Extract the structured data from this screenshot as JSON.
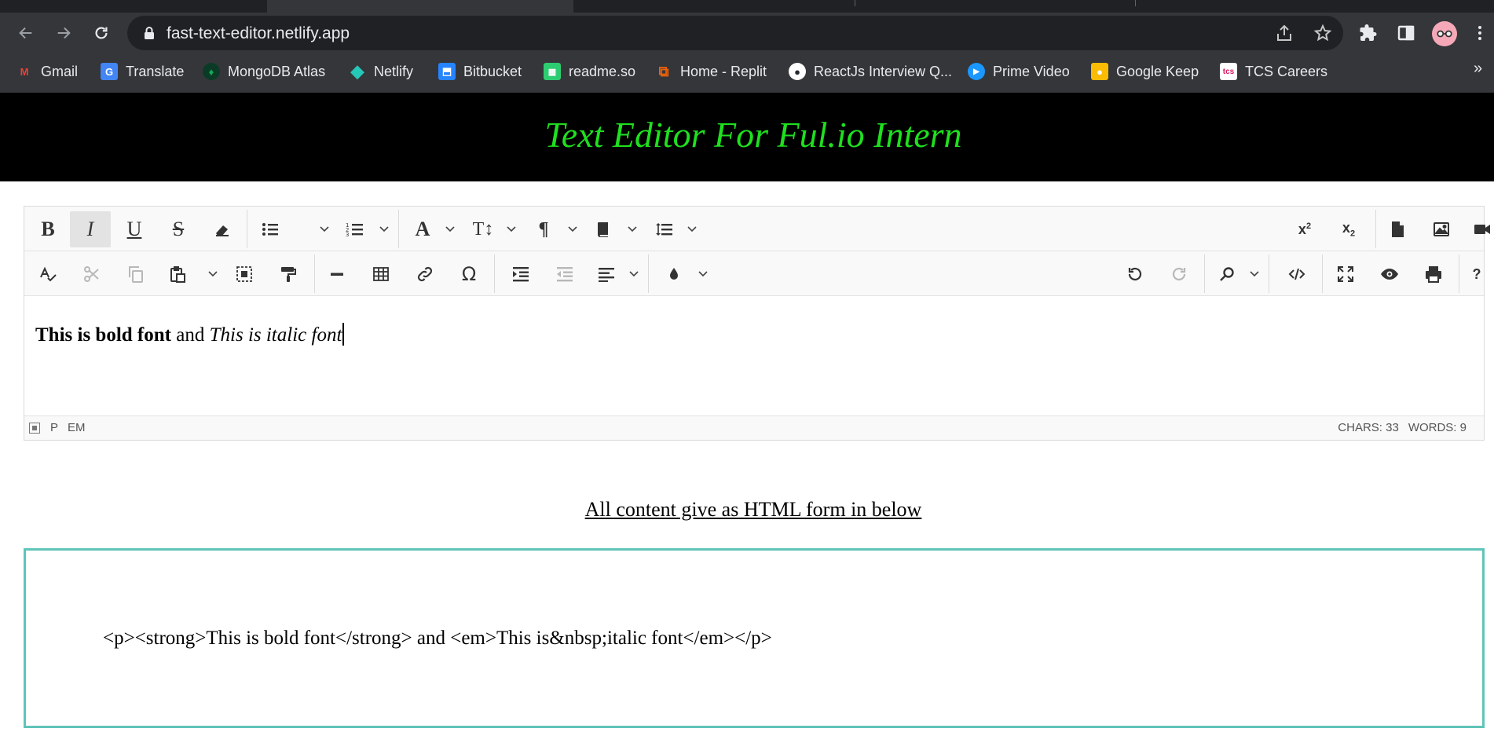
{
  "browser": {
    "url": "fast-text-editor.netlify.app",
    "bookmarks": [
      {
        "label": "Gmail",
        "icon": "gmail-icon",
        "color": "#ea4335"
      },
      {
        "label": "Translate",
        "icon": "translate-icon",
        "color": "#4285f4"
      },
      {
        "label": "MongoDB Atlas",
        "icon": "mongodb-icon",
        "color": "#13aa52"
      },
      {
        "label": "Netlify",
        "icon": "netlify-icon",
        "color": "#25c7b7"
      },
      {
        "label": "Bitbucket",
        "icon": "bitbucket-icon",
        "color": "#2684ff"
      },
      {
        "label": "readme.so",
        "icon": "readme-icon",
        "color": "#2ecc71"
      },
      {
        "label": "Home - Replit",
        "icon": "replit-icon",
        "color": "#f26207"
      },
      {
        "label": "ReactJs Interview Q...",
        "icon": "github-icon",
        "color": "#ffffff"
      },
      {
        "label": "Prime Video",
        "icon": "prime-video-icon",
        "color": "#1a98ff"
      },
      {
        "label": "Google Keep",
        "icon": "keep-icon",
        "color": "#fbbc04"
      },
      {
        "label": "TCS Careers",
        "icon": "tcs-icon",
        "color": "#e8eaed"
      }
    ],
    "overflow": "»"
  },
  "page": {
    "title": "Text Editor For Ful.io Intern",
    "html_caption": "All content give as HTML form in below",
    "html_output": "<p><strong>This is bold font</strong> and <em>This is&nbsp;italic font</em></p>"
  },
  "editor": {
    "content_bold": "This is bold font",
    "content_plain": " and ",
    "content_italic": "This is italic font",
    "status_path": [
      "P",
      "EM"
    ],
    "chars": "CHARS: 33",
    "words": "WORDS: 9",
    "toolbar_text": {
      "bold": "B",
      "italic": "I",
      "underline": "U",
      "strike": "S",
      "font_color": "A",
      "font_size": "T↕",
      "paragraph": "¶",
      "omega": "Ω",
      "help": "?"
    }
  },
  "colors": {
    "title_green": "#1fe01f",
    "output_border": "#5fc4b8",
    "chrome_bg": "#35363a"
  }
}
